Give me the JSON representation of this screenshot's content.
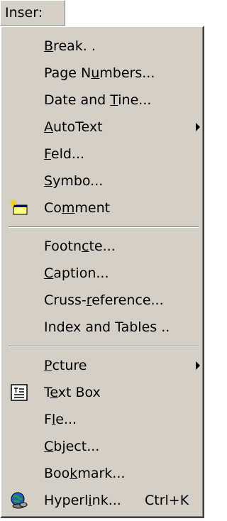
{
  "menubar": {
    "title": "Inser:"
  },
  "menu": {
    "items": [
      {
        "label_pre": "",
        "label_u": "B",
        "label_post": "reak. .",
        "has_submenu": false
      },
      {
        "label_pre": "Page N",
        "label_u": "u",
        "label_post": "mbers...",
        "has_submenu": false
      },
      {
        "label_pre": "Date and ",
        "label_u": "T",
        "label_post": "ine...",
        "has_submenu": false
      },
      {
        "label_pre": "",
        "label_u": "A",
        "label_post": "utoText",
        "has_submenu": true
      },
      {
        "label_pre": "",
        "label_u": "F",
        "label_post": "eld...",
        "has_submenu": false
      },
      {
        "label_pre": "",
        "label_u": "S",
        "label_post": "ymbo...",
        "has_submenu": false
      },
      {
        "label_pre": "Co",
        "label_u": "m",
        "label_post": "ment",
        "has_submenu": false,
        "icon": "comment-icon"
      },
      {
        "label_pre": "Footn",
        "label_u": "c",
        "label_post": "te...",
        "has_submenu": false
      },
      {
        "label_pre": "",
        "label_u": "C",
        "label_post": "aption...",
        "has_submenu": false
      },
      {
        "label_pre": "Cruss-",
        "label_u": "r",
        "label_post": "eference...",
        "has_submenu": false
      },
      {
        "label_pre": "Index and Tables ..",
        "label_u": "",
        "label_post": "",
        "has_submenu": false
      },
      {
        "label_pre": "",
        "label_u": "P",
        "label_post": "cture",
        "has_submenu": true
      },
      {
        "label_pre": "T",
        "label_u": "e",
        "label_post": "xt Box",
        "has_submenu": false,
        "icon": "text-box-icon"
      },
      {
        "label_pre": "F",
        "label_u": "l",
        "label_post": "e...",
        "has_submenu": false
      },
      {
        "label_pre": "",
        "label_u": "C",
        "label_post": "bject...",
        "has_submenu": false
      },
      {
        "label_pre": "Boo",
        "label_u": "k",
        "label_post": "mark...",
        "has_submenu": false
      },
      {
        "label_pre": "Hyperl",
        "label_u": "i",
        "label_post": "nk...",
        "has_submenu": false,
        "icon": "hyperlink-icon",
        "shortcut": "Ctrl+K"
      }
    ]
  },
  "colors": {
    "menu_bg": "#d4d0c8",
    "shadow": "#808080",
    "highlight": "#ffffff"
  }
}
